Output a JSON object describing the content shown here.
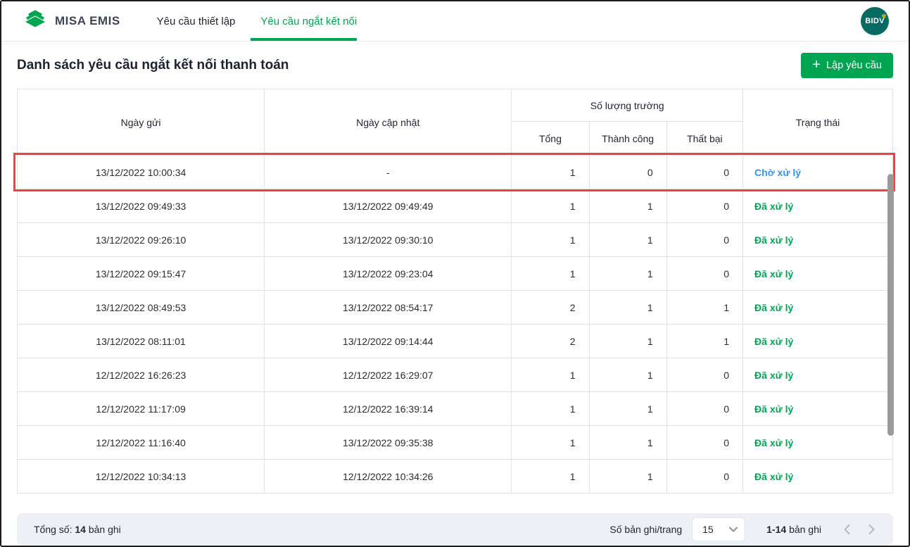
{
  "header": {
    "brand": "MISA EMIS",
    "tabs": [
      {
        "label": "Yêu cầu thiết lập",
        "active": false
      },
      {
        "label": "Yêu cầu ngắt kết nối",
        "active": true
      }
    ],
    "avatar_text": "BIDV"
  },
  "page": {
    "title": "Danh sách yêu cầu ngắt kết nối thanh toán",
    "create_button_label": "Lập yêu cầu"
  },
  "table": {
    "headers": {
      "sent_date": "Ngày gửi",
      "updated_date": "Ngày cập nhật",
      "fields_group": "Số lượng trường",
      "total": "Tổng",
      "success": "Thành công",
      "failed": "Thất bại",
      "status": "Trạng thái"
    },
    "rows": [
      {
        "sent": "13/12/2022 10:00:34",
        "updated": "-",
        "total": "1",
        "success": "0",
        "failed": "0",
        "status": "Chờ xử lý",
        "status_type": "pending",
        "highlighted": true
      },
      {
        "sent": "13/12/2022 09:49:33",
        "updated": "13/12/2022 09:49:49",
        "total": "1",
        "success": "1",
        "failed": "0",
        "status": "Đã xử lý",
        "status_type": "done",
        "highlighted": false
      },
      {
        "sent": "13/12/2022 09:26:10",
        "updated": "13/12/2022 09:30:10",
        "total": "1",
        "success": "1",
        "failed": "0",
        "status": "Đã xử lý",
        "status_type": "done",
        "highlighted": false
      },
      {
        "sent": "13/12/2022 09:15:47",
        "updated": "13/12/2022 09:23:04",
        "total": "1",
        "success": "1",
        "failed": "0",
        "status": "Đã xử lý",
        "status_type": "done",
        "highlighted": false
      },
      {
        "sent": "13/12/2022 08:49:53",
        "updated": "13/12/2022 08:54:17",
        "total": "2",
        "success": "1",
        "failed": "1",
        "status": "Đã xử lý",
        "status_type": "done",
        "highlighted": false
      },
      {
        "sent": "13/12/2022 08:11:01",
        "updated": "13/12/2022 09:14:44",
        "total": "2",
        "success": "1",
        "failed": "1",
        "status": "Đã xử lý",
        "status_type": "done",
        "highlighted": false
      },
      {
        "sent": "12/12/2022 16:26:23",
        "updated": "12/12/2022 16:29:07",
        "total": "1",
        "success": "1",
        "failed": "0",
        "status": "Đã xử lý",
        "status_type": "done",
        "highlighted": false
      },
      {
        "sent": "12/12/2022 11:17:09",
        "updated": "12/12/2022 16:39:14",
        "total": "1",
        "success": "1",
        "failed": "0",
        "status": "Đã xử lý",
        "status_type": "done",
        "highlighted": false
      },
      {
        "sent": "12/12/2022 11:16:40",
        "updated": "13/12/2022 09:35:38",
        "total": "1",
        "success": "1",
        "failed": "0",
        "status": "Đã xử lý",
        "status_type": "done",
        "highlighted": false
      },
      {
        "sent": "12/12/2022 10:34:13",
        "updated": "12/12/2022 10:34:26",
        "total": "1",
        "success": "1",
        "failed": "0",
        "status": "Đã xử lý",
        "status_type": "done",
        "highlighted": false
      }
    ]
  },
  "footer": {
    "total_label": "Tổng số:",
    "total_count": "14",
    "total_suffix": "bản ghi",
    "per_page_label": "Số bản ghi/trang",
    "per_page_value": "15",
    "range": "1-14",
    "range_suffix": "bản ghi"
  },
  "colors": {
    "green": "#00a551",
    "blue": "#2e96f2",
    "red": "#f4413f",
    "footer-bg": "#edf0f5"
  }
}
